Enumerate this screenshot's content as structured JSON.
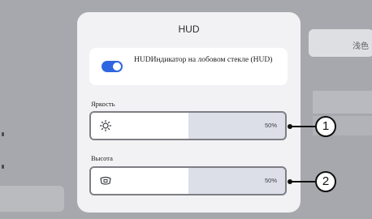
{
  "background": {
    "right_button_label": "浅色"
  },
  "dialog": {
    "title": "HUD",
    "hud_toggle": {
      "label": "HUDИндикатор на лобовом стекле (HUD)",
      "on": true,
      "color": "#2f66e0"
    },
    "brightness": {
      "label": "Яркость",
      "value": "50%",
      "level": 0.5,
      "icon": "sun-icon"
    },
    "height": {
      "label": "Высота",
      "value": "50%",
      "level": 0.5,
      "icon": "hud-height-icon"
    }
  },
  "callouts": [
    "1",
    "2"
  ]
}
